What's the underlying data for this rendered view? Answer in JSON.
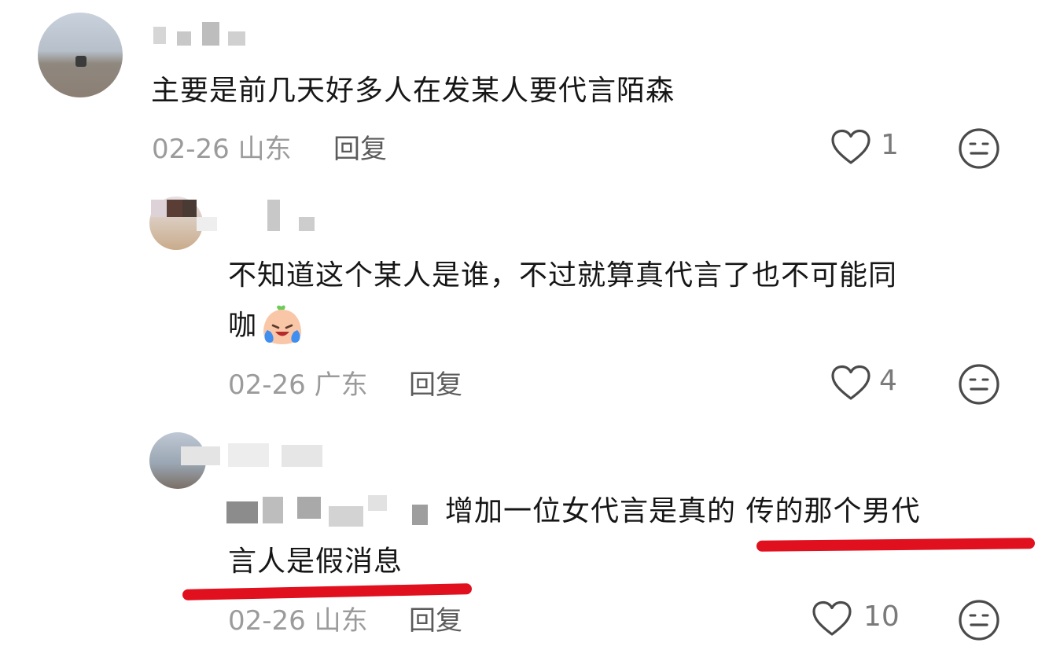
{
  "comments": [
    {
      "text": "主要是前几天好多人在发某人要代言陌森",
      "date": "02-26",
      "location": "山东",
      "reply_label": "回复",
      "like_count": "1"
    },
    {
      "text_line1": "不知道这个某人是谁，不过就算真代言了也不可能同",
      "text_line2": "咖",
      "emoji": "crying-laughing-emoji",
      "date": "02-26",
      "location": "广东",
      "reply_label": "回复",
      "like_count": "4"
    },
    {
      "text_line1_tail": "增加一位女代言是真的 传的那个男代",
      "text_line2": "言人是假消息",
      "date": "02-26",
      "location": "山东",
      "reply_label": "回复",
      "like_count": "10"
    }
  ],
  "icons": [
    "heart-icon",
    "neutral-face-icon"
  ],
  "colors": {
    "underline": "#e0101e",
    "meta": "#9b9b9b",
    "text": "#161616"
  }
}
